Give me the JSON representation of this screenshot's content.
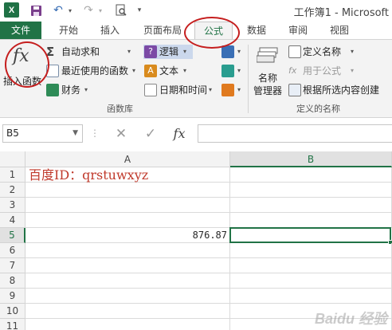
{
  "window": {
    "title": "工作簿1 - Microsoft"
  },
  "quick_access": {
    "app_icon": "excel-logo",
    "app_icon_text": "X",
    "icons": [
      "save-icon",
      "undo-icon",
      "redo-icon",
      "print-preview-icon",
      "customize-icon"
    ]
  },
  "tabs": [
    {
      "label": "文件",
      "style": "file"
    },
    {
      "label": "开始"
    },
    {
      "label": "插入"
    },
    {
      "label": "页面布局"
    },
    {
      "label": "公式",
      "active": true
    },
    {
      "label": "数据"
    },
    {
      "label": "审阅"
    },
    {
      "label": "视图"
    }
  ],
  "ribbon": {
    "function_library": {
      "insert_function": {
        "icon_text": "fx",
        "label": "插入函数"
      },
      "autosum": "自动求和",
      "recent": "最近使用的函数",
      "financial": "财务",
      "logical": "逻辑",
      "text": "文本",
      "datetime": "日期和时间",
      "group_label": "函数库"
    },
    "defined_names": {
      "name_manager_line1": "名称",
      "name_manager_line2": "管理器",
      "define_name": "定义名称",
      "use_in_formula": "用于公式",
      "create_from_selection": "根据所选内容创建",
      "group_label": "定义的名称"
    }
  },
  "formula_bar": {
    "name_box": "B5",
    "cancel_icon": "✕",
    "enter_icon": "✓",
    "fx_label": "fx",
    "value": ""
  },
  "sheet": {
    "columns": [
      "A",
      "B"
    ],
    "selected_column": "B",
    "rows": [
      "1",
      "2",
      "3",
      "4",
      "5",
      "6",
      "7",
      "8",
      "9",
      "10",
      "11"
    ],
    "selected_row": "5",
    "active_cell": "B5",
    "cells": {
      "A1": "百度ID：qrstuwxyz",
      "A5": "876.87"
    }
  },
  "watermark": "Baidu 经验",
  "colors": {
    "accent": "#217346",
    "annotation": "#c51e1e",
    "a1_text": "#c0392b"
  }
}
